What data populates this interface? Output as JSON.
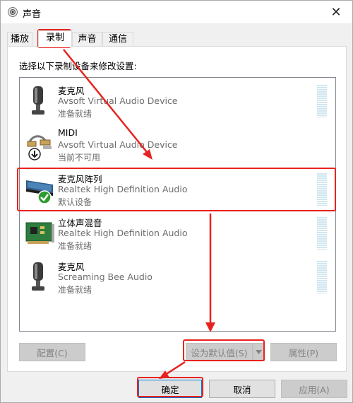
{
  "window": {
    "title": "声音",
    "close_glyph": "✕"
  },
  "tabs": [
    {
      "label": "播放",
      "active": false
    },
    {
      "label": "录制",
      "active": true
    },
    {
      "label": "声音",
      "active": false
    },
    {
      "label": "通信",
      "active": false
    }
  ],
  "instruction": "选择以下录制设备来修改设置:",
  "devices": [
    {
      "name": "麦克风",
      "description": "Avsoft Virtual Audio Device",
      "status": "准备就绪",
      "icon": "microphone-icon"
    },
    {
      "name": "MIDI",
      "description": "Avsoft Virtual Audio Device",
      "status": "当前不可用",
      "icon": "midi-cable-icon"
    },
    {
      "name": "麦克风阵列",
      "description": "Realtek High Definition Audio",
      "status": "默认设备",
      "icon": "mic-array-icon",
      "default": true
    },
    {
      "name": "立体声混音",
      "description": "Realtek High Definition Audio",
      "status": "准备就绪",
      "icon": "sound-card-icon"
    },
    {
      "name": "麦克风",
      "description": "Screaming Bee Audio",
      "status": "准备就绪",
      "icon": "microphone-icon"
    }
  ],
  "buttons": {
    "configure": "配置(C)",
    "set_default": "设为默认值(S)",
    "properties": "属性(P)",
    "ok": "确定",
    "cancel": "取消",
    "apply": "应用(A)"
  },
  "colors": {
    "annotation": "#e8231f",
    "check_badge": "#2f9b2f",
    "accent": "#0078d7"
  }
}
